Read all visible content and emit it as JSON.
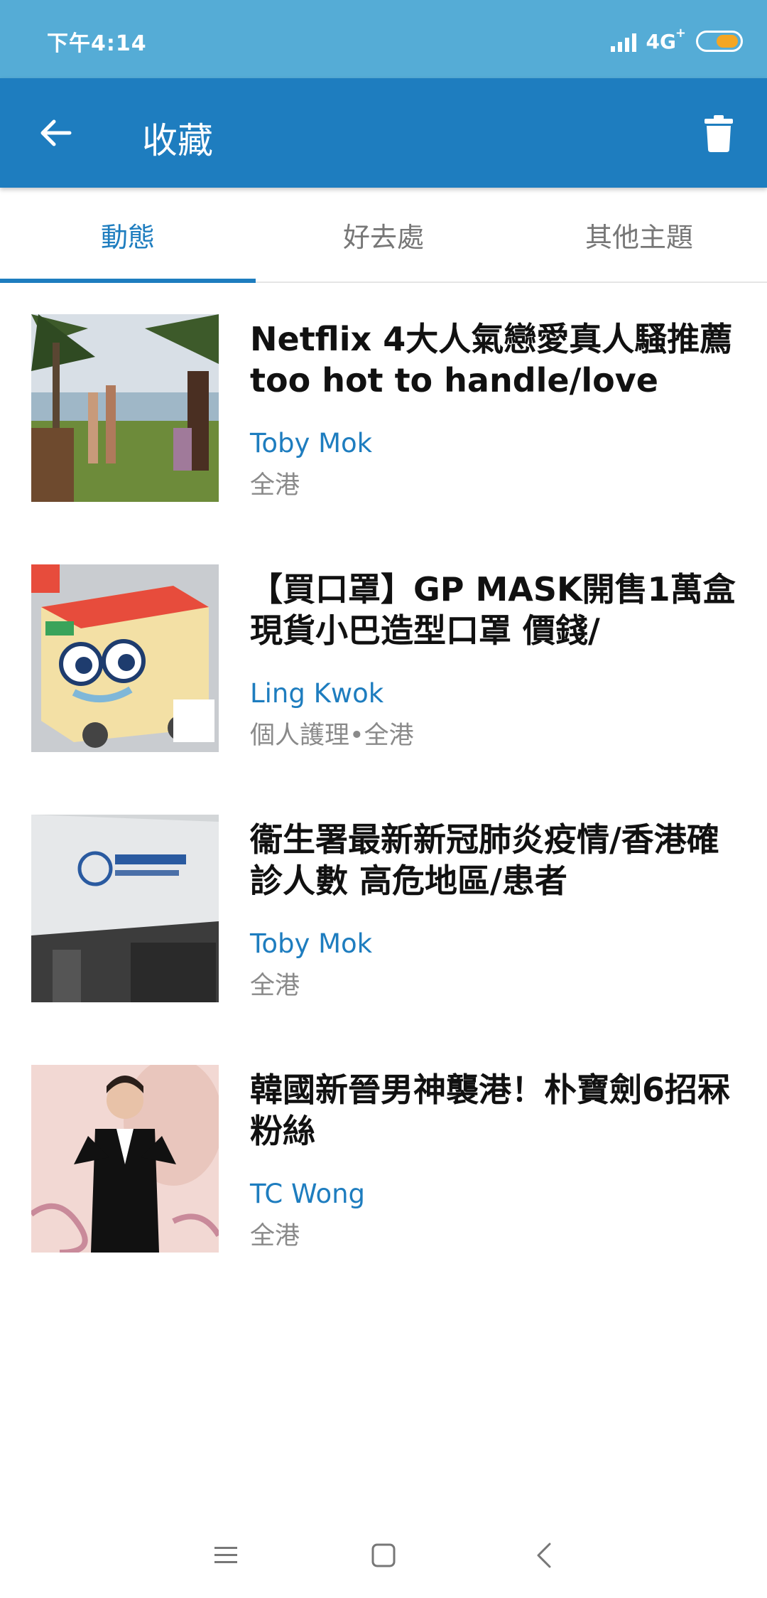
{
  "status_bar": {
    "time": "下午4:14",
    "network": "4G",
    "network_sup": "+",
    "battery_color": "#f5a623"
  },
  "app_bar": {
    "title": "收藏",
    "back_icon": "arrow-left-icon",
    "delete_icon": "trash-icon",
    "background": "#1e7dbf"
  },
  "tabs": [
    {
      "label": "動態",
      "active": true
    },
    {
      "label": "好去處",
      "active": false
    },
    {
      "label": "其他主題",
      "active": false
    }
  ],
  "items": [
    {
      "title": "Netflix 4大人氣戀愛真人騷推薦 too hot to handle/love",
      "author": "Toby Mok",
      "meta": "全港",
      "thumb": "beach-photo"
    },
    {
      "title": "【買口罩】GP MASK開售1萬盒現貨小巴造型口罩 價錢/",
      "author": "Ling Kwok",
      "meta": "個人護理•全港",
      "thumb": "mask-box-photo"
    },
    {
      "title": "衞生署最新新冠肺炎疫情/香港確診人數 高危地區/患者",
      "author": "Toby Mok",
      "meta": "全港",
      "thumb": "health-centre-photo"
    },
    {
      "title": "韓國新晉男神襲港！朴寶劍6招冧粉絲",
      "author": "TC Wong",
      "meta": "全港",
      "thumb": "celebrity-photo"
    }
  ],
  "nav_bar": {
    "menu_icon": "menu-icon",
    "home_icon": "home-square-icon",
    "back_icon": "back-chevron-icon"
  }
}
